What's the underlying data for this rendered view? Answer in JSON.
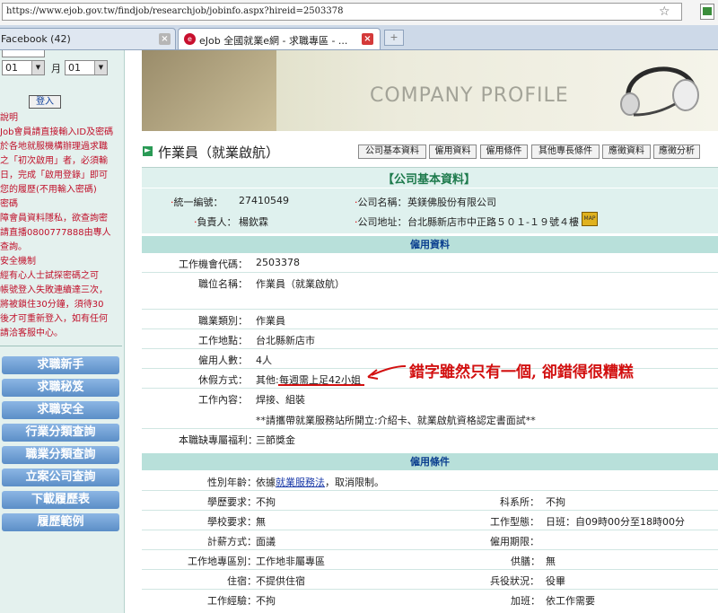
{
  "browser": {
    "url": "https://www.ejob.gov.tw/findjob/researchjob/jobinfo.aspx?hireid=2503378",
    "tabs": [
      {
        "label": "Facebook (42)"
      },
      {
        "label": "eJob 全國就業e網 - 求職專區 - ..."
      }
    ],
    "new_tab": "+"
  },
  "sidebar": {
    "month_value": "01",
    "month_label": "月",
    "day_value": "01",
    "login_button": "登入",
    "notes": [
      "說明",
      "Job會員請直接輸入ID及密碼",
      "於各地就服機構辦理過求職",
      "之「初次啟用」者，必須輸",
      "日，完成「啟用登錄」即可",
      "您的履歷(不用輸入密碼)",
      "密碼",
      "障會員資料隱私，欲查詢密",
      "請直播0800777888由專人",
      "查詢。",
      "安全機制",
      "經有心人士試探密碼之可",
      "帳號登入失敗連續達三次，",
      "將被鎖住30分鐘，須待30",
      "後才可重新登入，如有任何",
      "請洽客服中心。"
    ],
    "nav": [
      "求職新手",
      "求職秘笈",
      "求職安全",
      "行業分類查詢",
      "職業分類查詢",
      "立案公司查詢",
      "下載履歷表",
      "履歷範例"
    ]
  },
  "header": {
    "banner_text": "COMPANY PROFILE",
    "job_title": "作業員（就業啟航）",
    "tabs": [
      "公司基本資料",
      "僱用資料",
      "僱用條件",
      "其他專長條件",
      "應徵資料",
      "應徵分析"
    ]
  },
  "company": {
    "section_title": "【公司基本資料】",
    "tax_id_label": "統一編號：",
    "tax_id": "27410549",
    "name_label": "公司名稱：",
    "name": "英鎂佛股份有限公司",
    "owner_label": "負責人：",
    "owner": "楊欽霖",
    "address_label": "公司地址：",
    "address": "台北縣新店市中正路５０１-１９號４樓",
    "map_icon": "MAP"
  },
  "hire": {
    "section_title": "僱用資料",
    "rows": [
      {
        "label": "工作機會代碼：",
        "value": "2503378"
      },
      {
        "label": "職位名稱：",
        "value": "作業員（就業啟航）"
      },
      {
        "label": "職業類別：",
        "value": "作業員"
      },
      {
        "label": "工作地點：",
        "value": "台北縣新店市"
      },
      {
        "label": "僱用人數：",
        "value": "4人"
      },
      {
        "label": "休假方式：",
        "value_prefix": "其他:",
        "value": "每週需上足42小姐"
      },
      {
        "label": "工作內容：",
        "value": "焊接、組裝"
      },
      {
        "label": "",
        "value": "**請攜帶就業服務站所開立:介紹卡、就業啟航資格認定書面試**"
      },
      {
        "label": "本職缺專屬福利：",
        "value": "三節獎金"
      }
    ],
    "annotation": "錯字雖然只有一個, 卻錯得很糟糕"
  },
  "conditions": {
    "section_title": "僱用條件",
    "gender_label": "性別年齡：",
    "gender_prefix": "依據",
    "gender_link": "就業服務法",
    "gender_suffix": "，取消限制。",
    "rows": [
      {
        "l_label": "學歷要求：",
        "l_value": "不拘",
        "r_label": "科系所：",
        "r_value": "不拘"
      },
      {
        "l_label": "學校要求：",
        "l_value": "無",
        "r_label": "工作型態：",
        "r_value": "日班：自09時00分至18時00分"
      },
      {
        "l_label": "計薪方式：",
        "l_value": "面議",
        "r_label": "僱用期限：",
        "r_value": ""
      },
      {
        "l_label": "工作地專區別：",
        "l_value": "工作地非屬專區",
        "r_label": "供膳：",
        "r_value": "無"
      },
      {
        "l_label": "住宿：",
        "l_value": "不提供住宿",
        "r_label": "兵役狀況：",
        "r_value": "役畢"
      },
      {
        "l_label": "工作經驗：",
        "l_value": "不拘",
        "r_label": "加班：",
        "r_value": "依工作需要"
      }
    ]
  }
}
